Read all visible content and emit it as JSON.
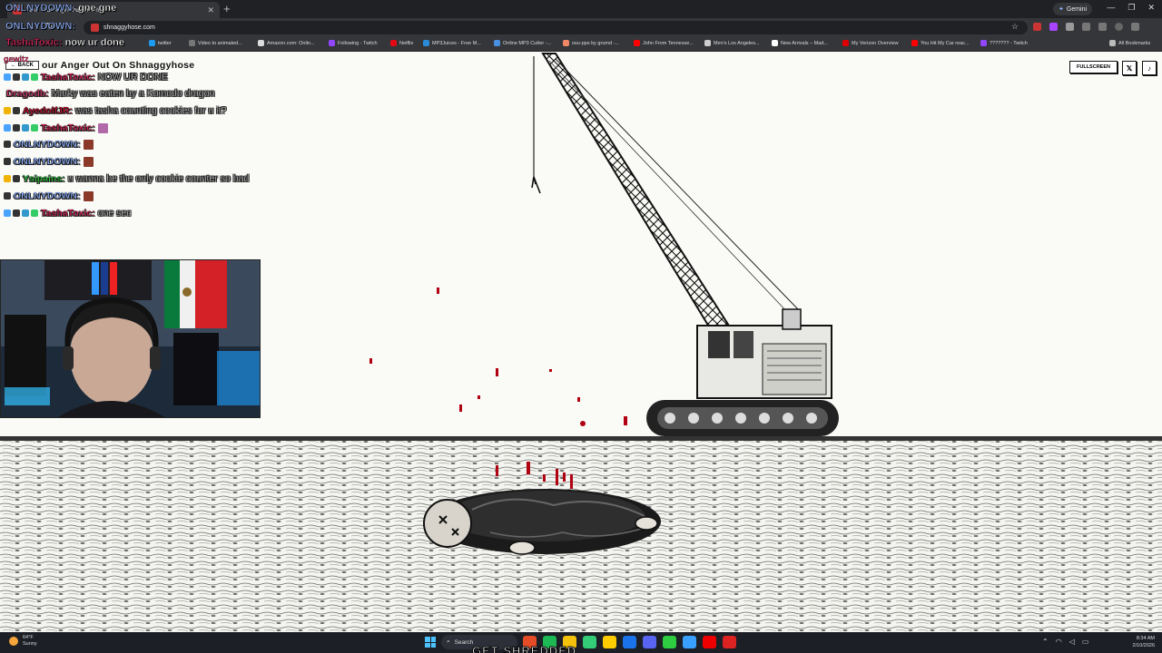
{
  "browser": {
    "tab_title": "Take Your Anger Out On Sh...",
    "url": "shnaggyhose.com",
    "gemini_label": "Gemini",
    "bookmarks": [
      {
        "label": "twitter",
        "color": "#1d9bf0"
      },
      {
        "label": "Video to animated...",
        "color": "#777"
      },
      {
        "label": "Amazon.com: Onlin...",
        "color": "#ddd"
      },
      {
        "label": "Following - Twitch",
        "color": "#9146ff"
      },
      {
        "label": "Netflix",
        "color": "#e50914"
      },
      {
        "label": "MP3Juices - Free M...",
        "color": "#2a8bd6"
      },
      {
        "label": "Online MP3 Cutter -...",
        "color": "#4a90e2"
      },
      {
        "label": "osu-pps by grumd -...",
        "color": "#e86"
      },
      {
        "label": "John From Tennesse...",
        "color": "#f00"
      },
      {
        "label": "Men's Los Angeles...",
        "color": "#ccc"
      },
      {
        "label": "New Arrivals – Mad...",
        "color": "#fff"
      },
      {
        "label": "My Verizon Overview",
        "color": "#d00"
      },
      {
        "label": "You Hit My Car reac...",
        "color": "#f00"
      },
      {
        "label": "??????? - Twitch",
        "color": "#9146ff"
      }
    ],
    "all_bookmarks": "All Bookmarks"
  },
  "page": {
    "back_label": "← BACK",
    "title": "our Anger Out On Shnaggyhose",
    "fullscreen_label": "FULLSCREEN",
    "x_label": "𝕏",
    "music_label": "♪"
  },
  "overlay": {
    "top_messages": [
      {
        "user": "ONLNYDOWN:",
        "text": "gne gne",
        "color": "#8fb3ff"
      },
      {
        "user": "ONLNYDOWN:",
        "text": "",
        "color": "#8fb3ff"
      },
      {
        "user": "TashaToxic:",
        "text": "now ur done",
        "color": "#e0245e"
      }
    ],
    "gewitz_label": "gewitz",
    "chat": [
      {
        "user": "TashaToxic:",
        "text": "NOW UR DONE",
        "color": "#e0245e",
        "badges": [
          "#4aa3ff",
          "#333",
          "#39c",
          "#3c6"
        ],
        "emote": ""
      },
      {
        "user": "Dragodb:",
        "text": "Marky was eaten by a Komodo dragon",
        "color": "#d23a6b",
        "badges": [],
        "emote": ""
      },
      {
        "user": "AyedolfJR:",
        "text": "was tasha counting cookies for u it?",
        "color": "#c8102e",
        "badges": [
          "#f0b400",
          "#333"
        ],
        "emote": ""
      },
      {
        "user": "TashaToxic:",
        "text": "",
        "color": "#e0245e",
        "badges": [
          "#4aa3ff",
          "#333",
          "#39c",
          "#3c6"
        ],
        "emote": "#b06aa8"
      },
      {
        "user": "ONLNYDOWN:",
        "text": "",
        "color": "#8fb3ff",
        "badges": [
          "#333"
        ],
        "emote": "#8b3a2a"
      },
      {
        "user": "ONLNYDOWN:",
        "text": "",
        "color": "#8fb3ff",
        "badges": [
          "#333"
        ],
        "emote": "#8b3a2a"
      },
      {
        "user": "Ysipains:",
        "text": "u wanna be the only cookie counter so bad",
        "color": "#2ecc40",
        "badges": [
          "#f0b400",
          "#333"
        ],
        "emote": ""
      },
      {
        "user": "ONLNYDOWN:",
        "text": "",
        "color": "#8fb3ff",
        "badges": [
          "#333"
        ],
        "emote": "#8b3a2a"
      },
      {
        "user": "TashaToxic:",
        "text": "one sec",
        "color": "#e0245e",
        "badges": [
          "#4aa3ff",
          "#333",
          "#39c",
          "#3c6"
        ],
        "emote": ""
      }
    ],
    "caption": "GET SHREDDED"
  },
  "taskbar": {
    "temperature": "64°F",
    "condition": "Sunny",
    "search_label": "Search",
    "time": "8:34 AM",
    "date": "2/10/2026",
    "apps": [
      "#e34c26",
      "#1db954",
      "#f4c20d",
      "#3c7",
      "#ffcc00",
      "#1a73e8",
      "#5865f2",
      "#2ecc40",
      "#3aa0ff",
      "#e00",
      "#d22"
    ]
  }
}
